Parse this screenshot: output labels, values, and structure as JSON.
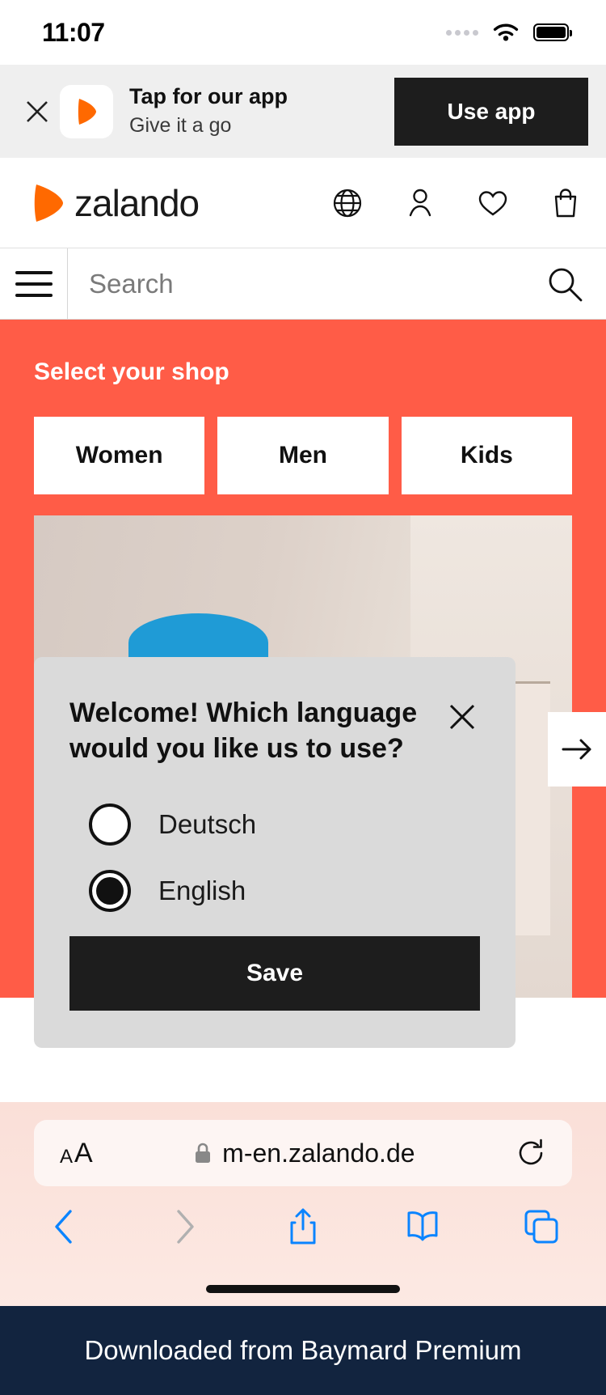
{
  "status_bar": {
    "time": "11:07",
    "wifi_icon": "wifi-icon",
    "battery_icon": "battery-icon",
    "signal_icon": "signal-dots-icon"
  },
  "app_banner": {
    "close_icon": "close-icon",
    "app_icon": "zalando-app-icon",
    "title": "Tap for our app",
    "subtitle": "Give it a go",
    "button_label": "Use app"
  },
  "site_header": {
    "logo_text": "zalando",
    "logo_icon": "zalando-logo-icon",
    "icons": [
      {
        "name": "globe-icon",
        "label": "Language"
      },
      {
        "name": "person-icon",
        "label": "Account"
      },
      {
        "name": "heart-icon",
        "label": "Wishlist"
      },
      {
        "name": "bag-icon",
        "label": "Cart"
      }
    ]
  },
  "search": {
    "menu_icon": "hamburger-menu-icon",
    "placeholder": "Search",
    "search_icon": "search-icon"
  },
  "shop_selector": {
    "title": "Select your shop",
    "options": [
      "Women",
      "Men",
      "Kids"
    ],
    "background_color": "#ff5c47"
  },
  "hero": {
    "next_icon": "arrow-right-icon",
    "carousel_indicator": "progress-bar"
  },
  "language_modal": {
    "title": "Welcome! Which language would you like us to use?",
    "close_icon": "close-icon",
    "options": [
      {
        "label": "Deutsch",
        "selected": false
      },
      {
        "label": "English",
        "selected": true
      }
    ],
    "save_label": "Save",
    "background_color": "#dadada"
  },
  "browser": {
    "text_size_label_small": "A",
    "text_size_label_large": "A",
    "lock_icon": "lock-icon",
    "url": "m-en.zalando.de",
    "reload_icon": "reload-icon",
    "toolbar": [
      {
        "name": "back-icon",
        "enabled": true
      },
      {
        "name": "forward-icon",
        "enabled": false
      },
      {
        "name": "share-icon",
        "enabled": true
      },
      {
        "name": "bookmarks-icon",
        "enabled": true
      },
      {
        "name": "tabs-icon",
        "enabled": true
      }
    ],
    "accent_color": "#0a84ff"
  },
  "footer": {
    "text": "Downloaded from Baymard Premium",
    "background_color": "#12243f"
  }
}
